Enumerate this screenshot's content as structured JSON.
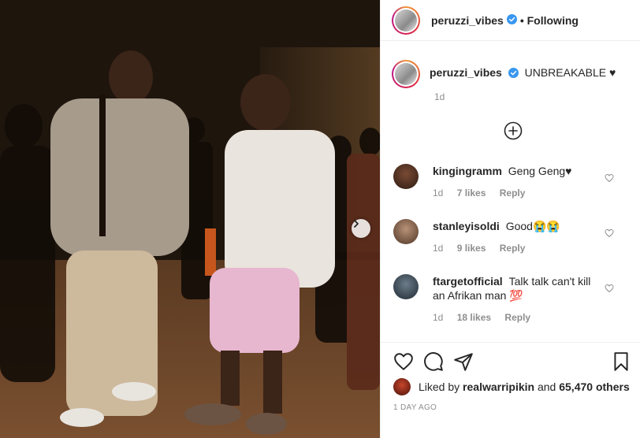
{
  "post": {
    "author": "peruzzi_vibes",
    "follow_status": "• Following",
    "caption_text": "UNBREAKABLE ♥",
    "caption_time": "1d",
    "liked_by_prefix": "Liked by",
    "liked_by_user": "realwarripikin",
    "liked_by_connector": "and",
    "liked_by_others": "65,470 others",
    "date": "1 DAY AGO"
  },
  "comments": [
    {
      "user": "kingingramm",
      "text": "Geng Geng♥",
      "time": "1d",
      "likes": "7 likes",
      "reply": "Reply",
      "avatar_color": "#5a3a2a"
    },
    {
      "user": "stanleyisoldi",
      "text": "Good😭😭",
      "time": "1d",
      "likes": "9 likes",
      "reply": "Reply",
      "avatar_color": "#9a7a63"
    },
    {
      "user": "ftargetofficial",
      "text": "Talk talk can't kill an Afrikan man 💯",
      "time": "1d",
      "likes": "18 likes",
      "reply": "Reply",
      "avatar_color": "#3f5060"
    }
  ],
  "icons": {
    "verified": "verified-badge-icon",
    "next": "chevron-right-icon",
    "load_more": "plus-circle-icon",
    "like": "heart-icon",
    "comment": "comment-icon",
    "share": "paper-plane-icon",
    "save": "bookmark-icon"
  },
  "colors": {
    "verified_blue": "#3897f0",
    "text": "#262626",
    "muted": "#8e8e8e"
  }
}
